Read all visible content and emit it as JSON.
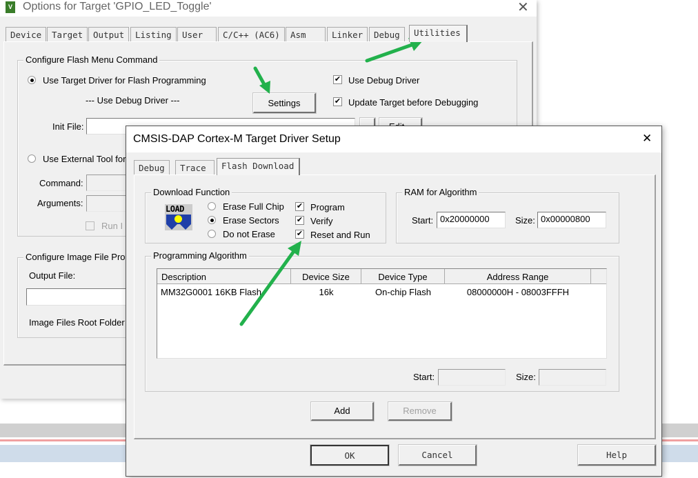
{
  "back_window": {
    "title": "Options for Target 'GPIO_LED_Toggle'",
    "tabs": [
      "Device",
      "Target",
      "Output",
      "Listing",
      "User",
      "C/C++ (AC6)",
      "Asm",
      "Linker",
      "Debug",
      "Utilities"
    ],
    "selected_tab": "Utilities",
    "flash_group": {
      "title": "Configure Flash Menu Command",
      "use_target_driver": "Use Target Driver for Flash Programming",
      "use_target_driver_selected": true,
      "driver_name": "--- Use Debug Driver ---",
      "settings_button": "Settings",
      "use_debug_driver": "Use Debug Driver",
      "use_debug_driver_checked": true,
      "update_target": "Update Target before Debugging",
      "update_target_checked": true,
      "init_file_label": "Init File:",
      "init_file_value": "",
      "edit_button": "Edit...",
      "use_external_tool": "Use External Tool for",
      "command_label": "Command:",
      "arguments_label": "Arguments:",
      "run_label": "Run I"
    },
    "image_group": {
      "title": "Configure Image File Pro",
      "output_file_label": "Output File:",
      "root_folder_label": "Image Files Root Folder"
    }
  },
  "dialog": {
    "title": "CMSIS-DAP Cortex-M Target Driver Setup",
    "tabs": [
      "Debug",
      "Trace",
      "Flash Download"
    ],
    "selected_tab": "Flash Download",
    "download_function": {
      "title": "Download Function",
      "icon_text": "LOAD",
      "erase_options": [
        "Erase Full Chip",
        "Erase Sectors",
        "Do not Erase"
      ],
      "erase_selected": "Erase Sectors",
      "checks": [
        {
          "label": "Program",
          "checked": true
        },
        {
          "label": "Verify",
          "checked": true
        },
        {
          "label": "Reset and Run",
          "checked": true
        }
      ]
    },
    "ram": {
      "title": "RAM for Algorithm",
      "start_label": "Start:",
      "start_value": "0x20000000",
      "size_label": "Size:",
      "size_value": "0x00000800"
    },
    "algorithm": {
      "title": "Programming Algorithm",
      "columns": [
        "Description",
        "Device Size",
        "Device Type",
        "Address Range"
      ],
      "rows": [
        [
          "MM32G0001 16KB Flash",
          "16k",
          "On-chip Flash",
          "08000000H - 08003FFFH"
        ]
      ],
      "start_label": "Start:",
      "size_label": "Size:"
    },
    "add_button": "Add",
    "remove_button": "Remove",
    "ok_button": "OK",
    "cancel_button": "Cancel",
    "help_button": "Help"
  },
  "annotation_color": "#22b14c"
}
